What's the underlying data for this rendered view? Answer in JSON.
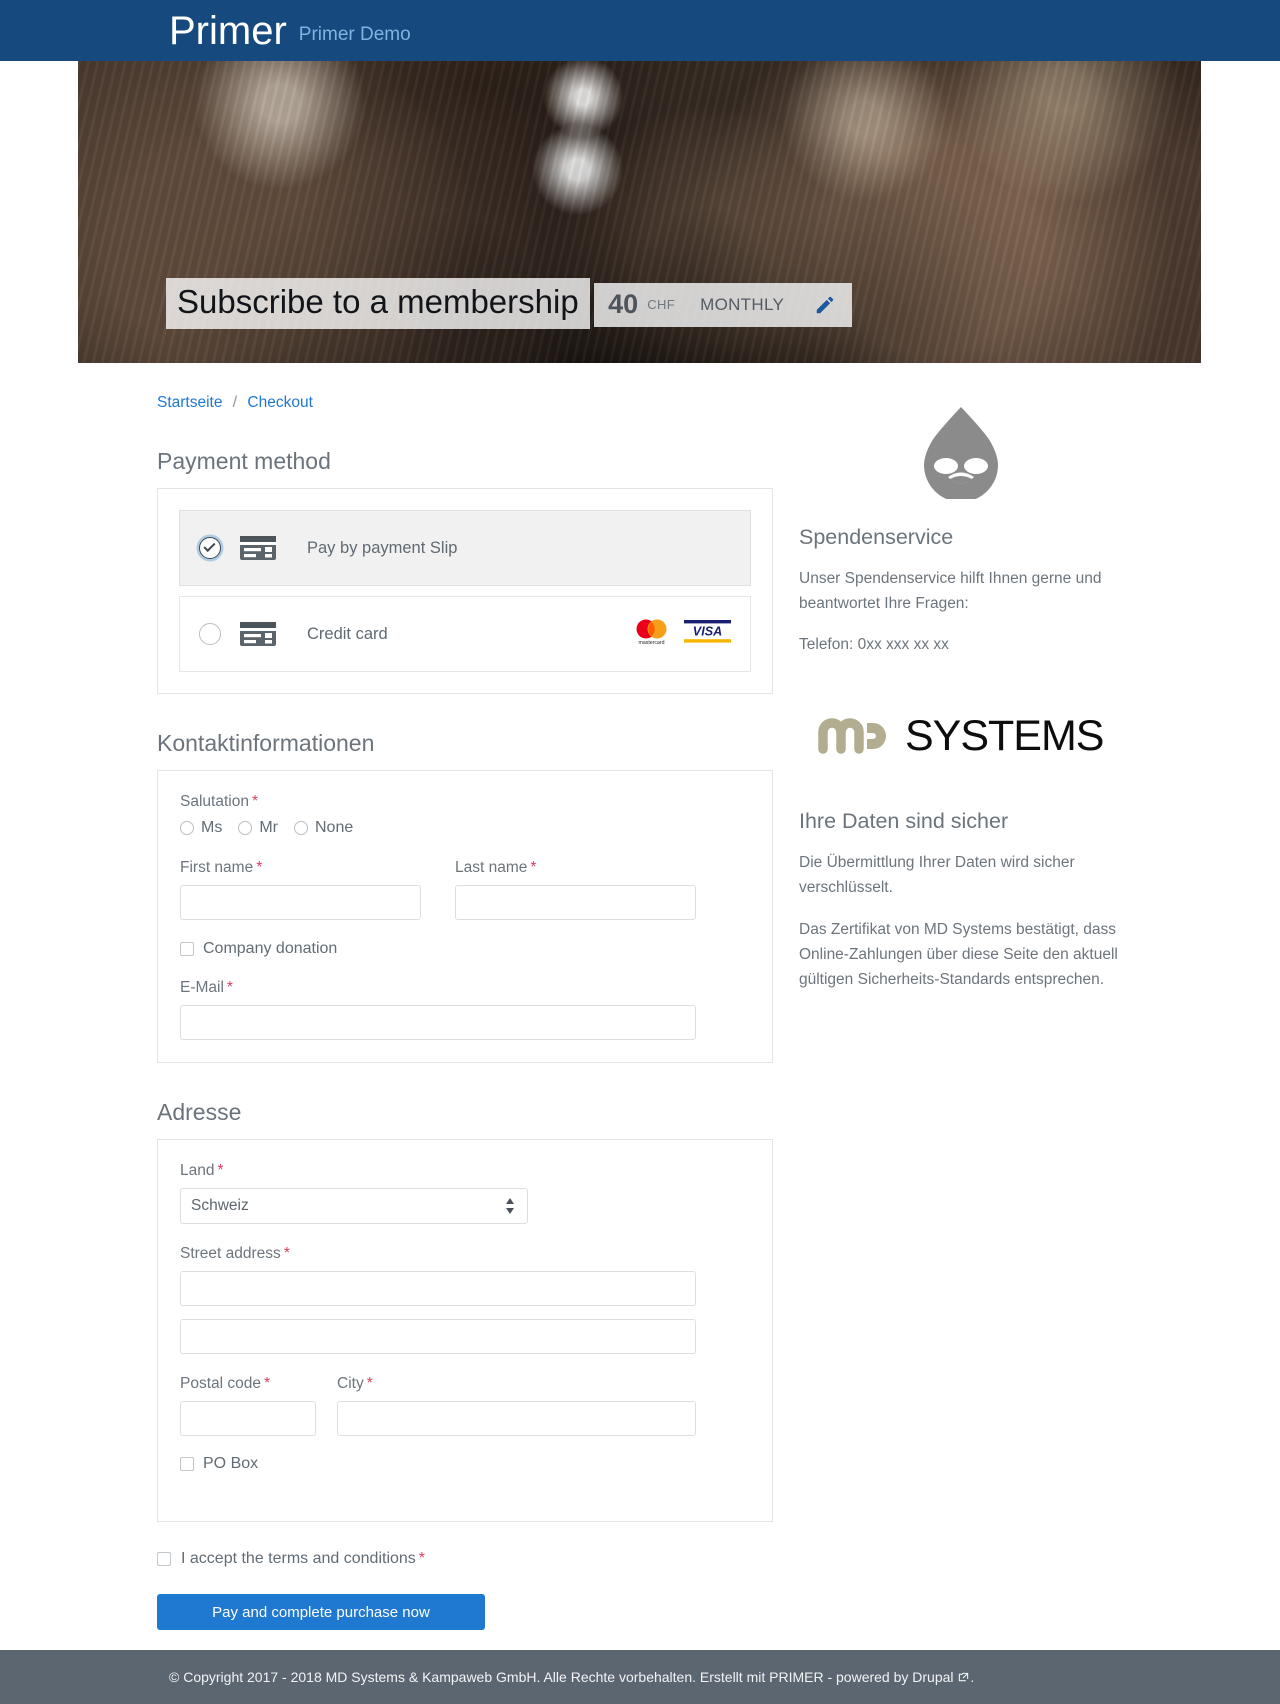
{
  "header": {
    "brand": "Primer",
    "subtitle": "Primer Demo"
  },
  "hero": {
    "title": "Subscribe to a membership",
    "price_amount": "40",
    "currency": "CHF",
    "interval": "MONTHLY",
    "edit_icon": "pencil-icon"
  },
  "breadcrumb": {
    "home": "Startseite",
    "separator": "/",
    "current": "Checkout"
  },
  "payment": {
    "section_title": "Payment method",
    "options": [
      {
        "label": "Pay by payment Slip",
        "selected": true,
        "icon": "credit-card-icon"
      },
      {
        "label": "Credit card",
        "selected": false,
        "icon": "credit-card-icon",
        "brands": [
          "mastercard",
          "visa"
        ]
      }
    ],
    "mastercard_word": "mastercard",
    "visa_word": "VISA"
  },
  "contact": {
    "section_title": "Kontaktinformationen",
    "salutation_label": "Salutation",
    "salutation_options": [
      "Ms",
      "Mr",
      "None"
    ],
    "first_name_label": "First name",
    "first_name_value": "",
    "last_name_label": "Last name",
    "last_name_value": "",
    "company_donation_label": "Company donation",
    "email_label": "E-Mail",
    "email_value": "",
    "required_marker": "*"
  },
  "address": {
    "section_title": "Adresse",
    "country_label": "Land",
    "country_value": "Schweiz",
    "street_label": "Street address",
    "street_value": "",
    "street2_value": "",
    "postal_label": "Postal code",
    "postal_value": "",
    "city_label": "City",
    "city_value": "",
    "po_box_label": "PO Box"
  },
  "submit": {
    "terms_label": "I accept the terms and conditions",
    "button_label": "Pay and complete purchase now"
  },
  "sidebar": {
    "drupal_icon": "drupal-droplet-icon",
    "service_title": "Spendenservice",
    "service_text_1": "Unser Spendenservice hilft Ihnen gerne und beantwortet Ihre Fragen:",
    "service_text_2": "Telefon: 0xx xxx xx xx",
    "md_logo_mark": "mo",
    "md_logo_word": "SYSTEMS",
    "security_title": "Ihre Daten sind sicher",
    "security_text_1": "Die Übermittlung Ihrer Daten wird sicher verschlüsselt.",
    "security_text_2": "Das Zertifikat von MD Systems bestätigt, dass Online-Zahlungen über diese Seite den aktuell gültigen Sicherheits-Standards entsprechen."
  },
  "footer": {
    "text": "© Copyright 2017 - 2018 MD Systems & Kampaweb GmbH. Alle Rechte vorbehalten. Erstellt mit PRIMER - powered by Drupal",
    "external_icon": "external-link-icon",
    "period": "."
  },
  "colors": {
    "header_blue": "#164a7e",
    "link_blue": "#1f78d1",
    "button_blue": "#1f79d0",
    "footer_gray": "#5c6670",
    "required_red": "#d9415f",
    "md_khaki": "#b2ad90"
  }
}
